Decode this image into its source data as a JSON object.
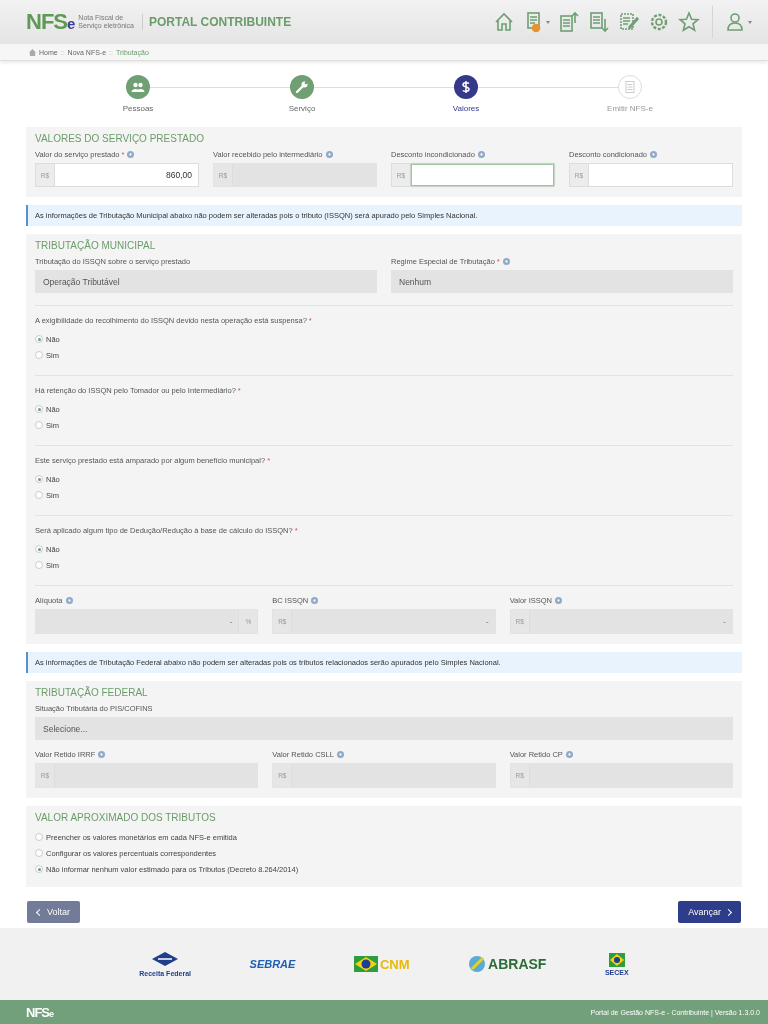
{
  "header": {
    "logo": "NFS",
    "logo_e": "e",
    "logo_sub": [
      "Nota Fiscal de",
      "Serviço eletrônica"
    ],
    "portal": "PORTAL CONTRIBUINTE",
    "toolbar": [
      {
        "kind": "home"
      },
      {
        "kind": "new-doc",
        "menu": true
      },
      {
        "kind": "upload"
      },
      {
        "kind": "download"
      },
      {
        "kind": "edit"
      },
      {
        "kind": "settings"
      },
      {
        "kind": "star"
      },
      {
        "kind": "user",
        "menu": true
      }
    ]
  },
  "breadcrumb": [
    {
      "label": "Home",
      "current": false
    },
    {
      "sep": "::",
      "label": "Nova NFS-e",
      "current": false
    },
    {
      "sep": "::",
      "label": "Tributação",
      "current": true
    }
  ],
  "steps": [
    {
      "label": "Pessoas",
      "completed": true,
      "selected": false,
      "kind": "people"
    },
    {
      "label": "Serviço",
      "completed": true,
      "selected": false,
      "kind": "wrench"
    },
    {
      "label": "Valores",
      "selected": true,
      "kind": "dollar"
    },
    {
      "label": "Emitir NFS-e",
      "completed": false,
      "selected": false,
      "kind": "doc"
    }
  ],
  "valores": {
    "title": "VALORES DO SERVIÇO PRESTADO",
    "fields": [
      {
        "label": "Valor do serviço prestado",
        "required": "*",
        "help": true,
        "prefix": "R$",
        "value": "860,00",
        "disabled": false,
        "focused": false
      },
      {
        "label": "Valor recebido pelo intermediário",
        "help": true,
        "prefix": "R$",
        "disabled": true,
        "focused": false
      },
      {
        "label": "Desconto incondicionado",
        "help": true,
        "prefix": "R$",
        "disabled": false,
        "focused": true
      },
      {
        "label": "Desconto condicionado",
        "help": true,
        "prefix": "R$",
        "disabled": false,
        "focused": false
      }
    ]
  },
  "notice_municipal": "As informações de Tributação Municipal abaixo não podem ser alteradas pois o tributo (ISSQN) será apurado pelo Simples Nacional.",
  "municipal": {
    "title": "TRIBUTAÇÃO MUNICIPAL",
    "selects": [
      {
        "label": "Tributação do ISSQN sobre o serviço prestado",
        "help": false,
        "value": "Operação Tributável"
      },
      {
        "label": "Regime Especial de Tributação",
        "required": "*",
        "help": true,
        "value": "Nenhum"
      }
    ],
    "questions": [
      {
        "text": "A exigibilidade do recolhimento do ISSQN devido nesta operação está suspensa?",
        "required": "*",
        "options": [
          {
            "label": "Não",
            "selected": true
          },
          {
            "label": "Sim",
            "selected": false
          }
        ]
      },
      {
        "text": "Há retenção do ISSQN pelo Tomador ou pelo Intermediário?",
        "required": "*",
        "options": [
          {
            "label": "Não",
            "selected": true
          },
          {
            "label": "Sim",
            "selected": false
          }
        ]
      },
      {
        "text": "Este serviço prestado está amparado por algum benefício municipal?",
        "required": "*",
        "options": [
          {
            "label": "Não",
            "selected": true
          },
          {
            "label": "Sim",
            "selected": false
          }
        ]
      },
      {
        "text": "Será aplicado algum tipo de Dedução/Redução à base de cálculo do ISSQN?",
        "required": "*",
        "options": [
          {
            "label": "Não",
            "selected": true
          },
          {
            "label": "Sim",
            "selected": false
          }
        ]
      }
    ],
    "fields": [
      {
        "label": "Alíquota",
        "help": true,
        "value": "-",
        "suffix": "%",
        "disabled": true
      },
      {
        "label": "BC ISSQN",
        "help": true,
        "prefix": "R$",
        "value": "-",
        "disabled": true
      },
      {
        "label": "Valor ISSQN",
        "help": true,
        "prefix": "R$",
        "value": "-",
        "disabled": true
      }
    ]
  },
  "notice_federal": "As informações de Tributação Federal abaixo não podem ser alteradas pois os tributos relacionados serão apurados pelo Simples Nacional.",
  "federal": {
    "title": "TRIBUTAÇÃO FEDERAL",
    "select": {
      "label": "Situação Tributária do PIS/COFINS",
      "value": "Selecione..."
    },
    "fields": [
      {
        "label": "Valor Retido IRRF",
        "help": true,
        "prefix": "R$",
        "disabled": true
      },
      {
        "label": "Valor Retido CSLL",
        "help": true,
        "prefix": "R$",
        "disabled": true
      },
      {
        "label": "Valor Retido CP",
        "help": true,
        "prefix": "R$",
        "disabled": true
      }
    ]
  },
  "aproximado": {
    "title": "VALOR APROXIMADO DOS TRIBUTOS",
    "options": [
      {
        "label": "Preencher os valores monetários em cada NFS-e emitida",
        "selected": false
      },
      {
        "label": "Configurar os valores percentuais correspondentes",
        "selected": false
      },
      {
        "label": "Não informar nenhum valor estimado para os Tributos (Decreto 8.264/2014)",
        "selected": true
      }
    ]
  },
  "buttons": {
    "back": "Voltar",
    "next": "Avançar"
  },
  "partners": [
    {
      "kind": "receita",
      "text": "Receita Federal"
    },
    {
      "kind": "sebrae",
      "text": "SEBRAE"
    },
    {
      "kind": "cnm",
      "text": "CNM"
    },
    {
      "kind": "abrasf",
      "text": "ABRASF"
    },
    {
      "kind": "secex",
      "text": "SECEX"
    }
  ],
  "footer": {
    "logo": "NFS",
    "logo_e": "e",
    "version": "Portal de Gestão NFS-e - Contribuinte | Versão 1.3.0.0"
  }
}
